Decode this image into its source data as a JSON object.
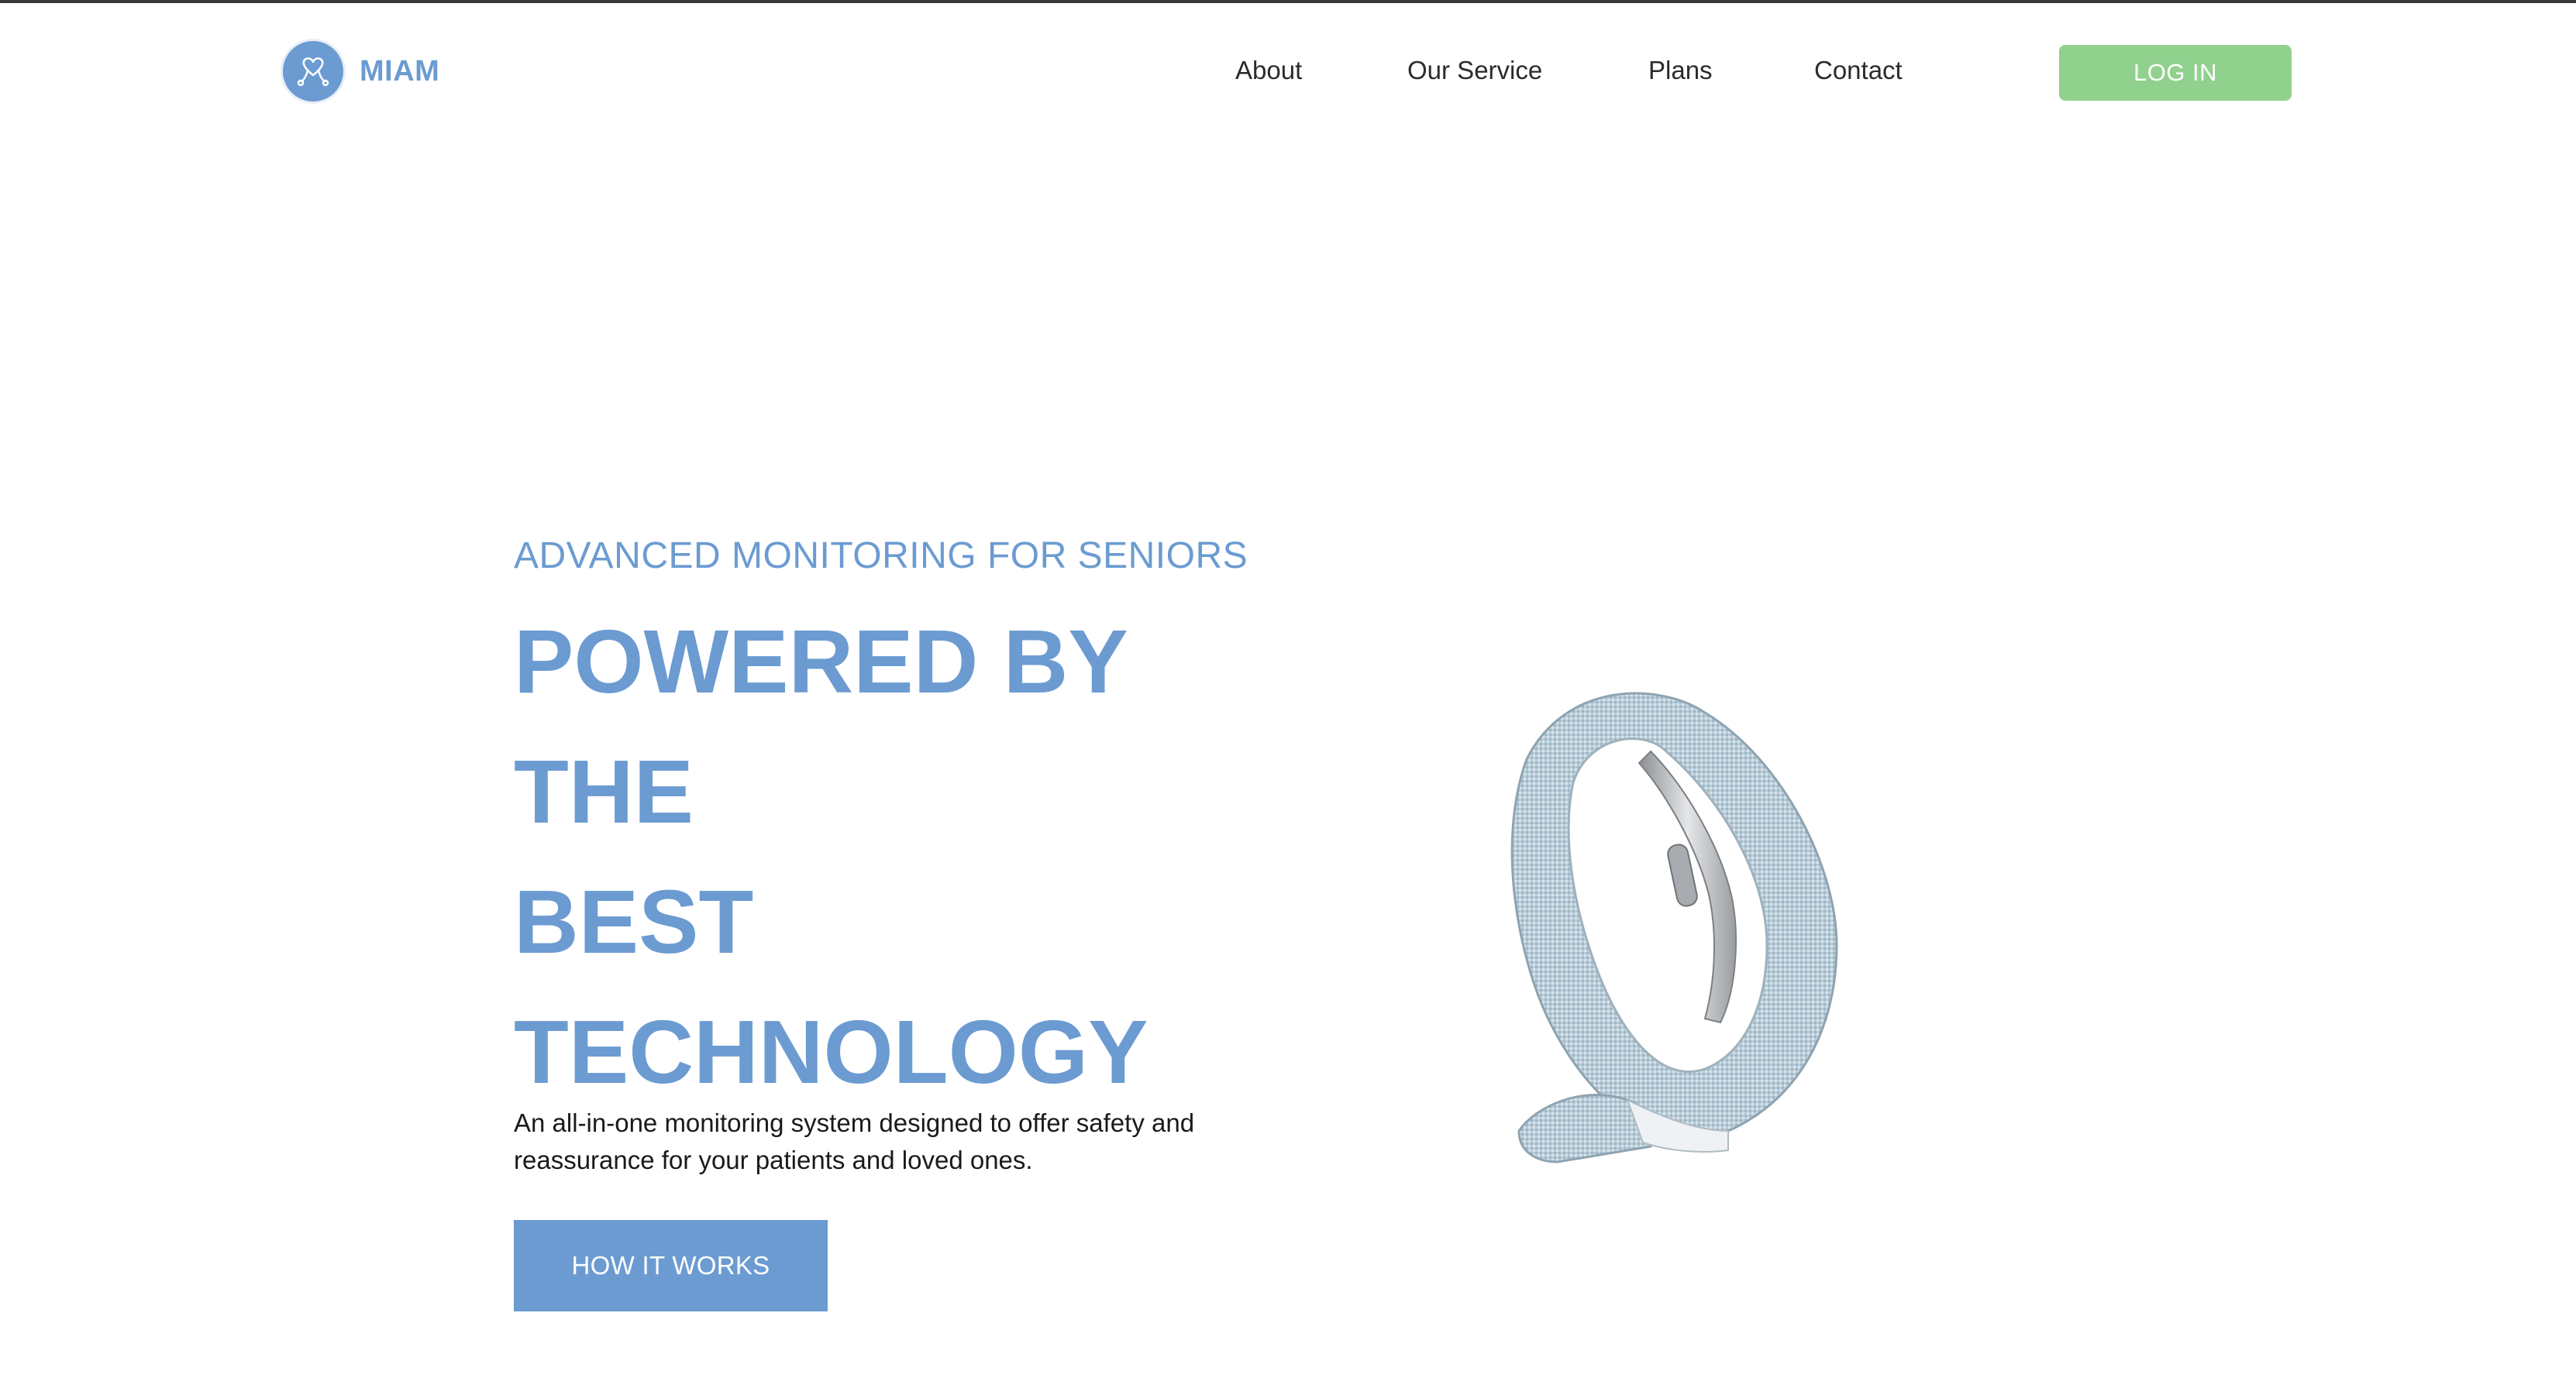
{
  "header": {
    "brand": "MIAM",
    "nav": {
      "about": "About",
      "service": "Our Service",
      "plans": "Plans",
      "contact": "Contact"
    },
    "login_label": "LOG IN"
  },
  "hero": {
    "eyebrow": "ADVANCED MONITORING FOR SENIORS",
    "headline": [
      "POWERED BY",
      "THE",
      "BEST",
      "TECHNOLOGY"
    ],
    "description_line1": "An all-in-one monitoring system designed to offer safety and",
    "description_line2": "reassurance for your patients and loved ones.",
    "cta_label": "HOW IT WORKS"
  },
  "colors": {
    "brand_blue": "#6b9bd1",
    "login_green": "#90d18e"
  },
  "icons": {
    "logo": "heart-stethoscope-icon",
    "product": "fitness-band-image"
  }
}
